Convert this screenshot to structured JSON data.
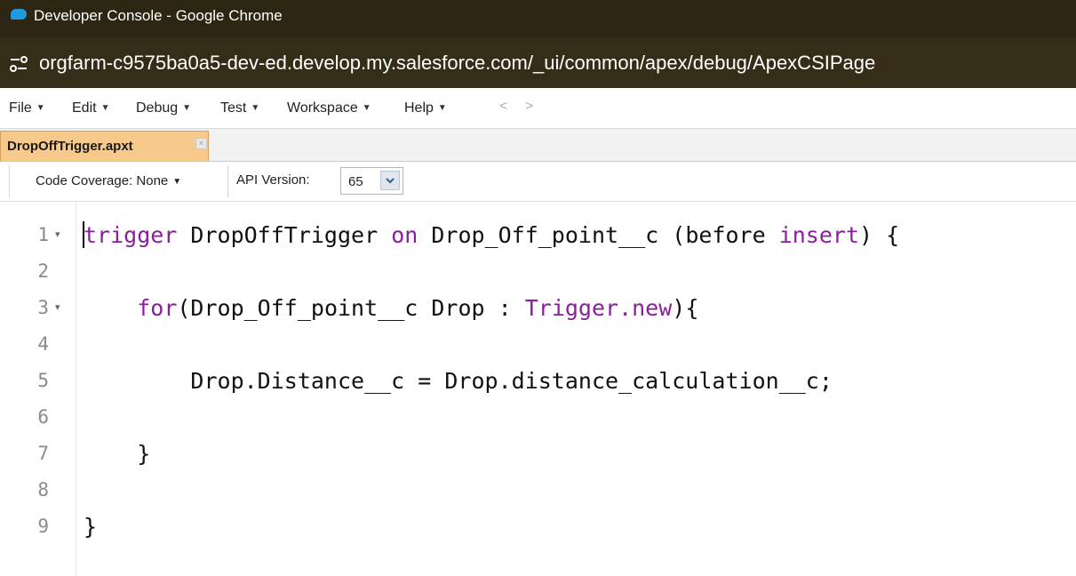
{
  "window": {
    "title": "Developer Console - Google Chrome",
    "url": "orgfarm-c9575ba0a5-dev-ed.develop.my.salesforce.com/_ui/common/apex/debug/ApexCSIPage"
  },
  "menu": {
    "items": [
      {
        "label": "File"
      },
      {
        "label": "Edit"
      },
      {
        "label": "Debug"
      },
      {
        "label": "Test"
      },
      {
        "label": "Workspace"
      },
      {
        "label": "Help"
      }
    ],
    "back_label": "<",
    "forward_label": ">"
  },
  "tab": {
    "label": "DropOffTrigger.apxt",
    "close_glyph": "×"
  },
  "toolbar": {
    "coverage_label": "Code Coverage: None",
    "api_label": "API Version:",
    "api_value": "65"
  },
  "editor": {
    "lines": [
      {
        "number": "1",
        "fold": "▾",
        "segments": [
          {
            "text": "trigger",
            "kind": "keyword"
          },
          {
            "text": " DropOffTrigger ",
            "kind": "plain"
          },
          {
            "text": "on",
            "kind": "keyword"
          },
          {
            "text": " Drop_Off_point__c (before ",
            "kind": "plain"
          },
          {
            "text": "insert",
            "kind": "keyword"
          },
          {
            "text": ") {",
            "kind": "plain"
          }
        ]
      },
      {
        "number": "2",
        "fold": "",
        "segments": []
      },
      {
        "number": "3",
        "fold": "▾",
        "segments": [
          {
            "text": "    ",
            "kind": "plain"
          },
          {
            "text": "for",
            "kind": "keyword"
          },
          {
            "text": "(Drop_Off_point__c Drop : ",
            "kind": "plain"
          },
          {
            "text": "Trigger.new",
            "kind": "keyword"
          },
          {
            "text": "){",
            "kind": "plain"
          }
        ]
      },
      {
        "number": "4",
        "fold": "",
        "segments": []
      },
      {
        "number": "5",
        "fold": "",
        "segments": [
          {
            "text": "        Drop.Distance__c = Drop.distance_calculation__c;",
            "kind": "plain"
          }
        ]
      },
      {
        "number": "6",
        "fold": "",
        "segments": []
      },
      {
        "number": "7",
        "fold": "",
        "segments": [
          {
            "text": "    }",
            "kind": "plain"
          }
        ]
      },
      {
        "number": "8",
        "fold": "",
        "segments": []
      },
      {
        "number": "9",
        "fold": "",
        "segments": [
          {
            "text": "}",
            "kind": "plain"
          }
        ]
      }
    ]
  },
  "colors": {
    "titlebar": "#2c2613",
    "urlbar": "#352d18",
    "tab_active": "#f7c98b",
    "keyword": "#8a1f9e",
    "line_number": "#8a8a8a"
  }
}
